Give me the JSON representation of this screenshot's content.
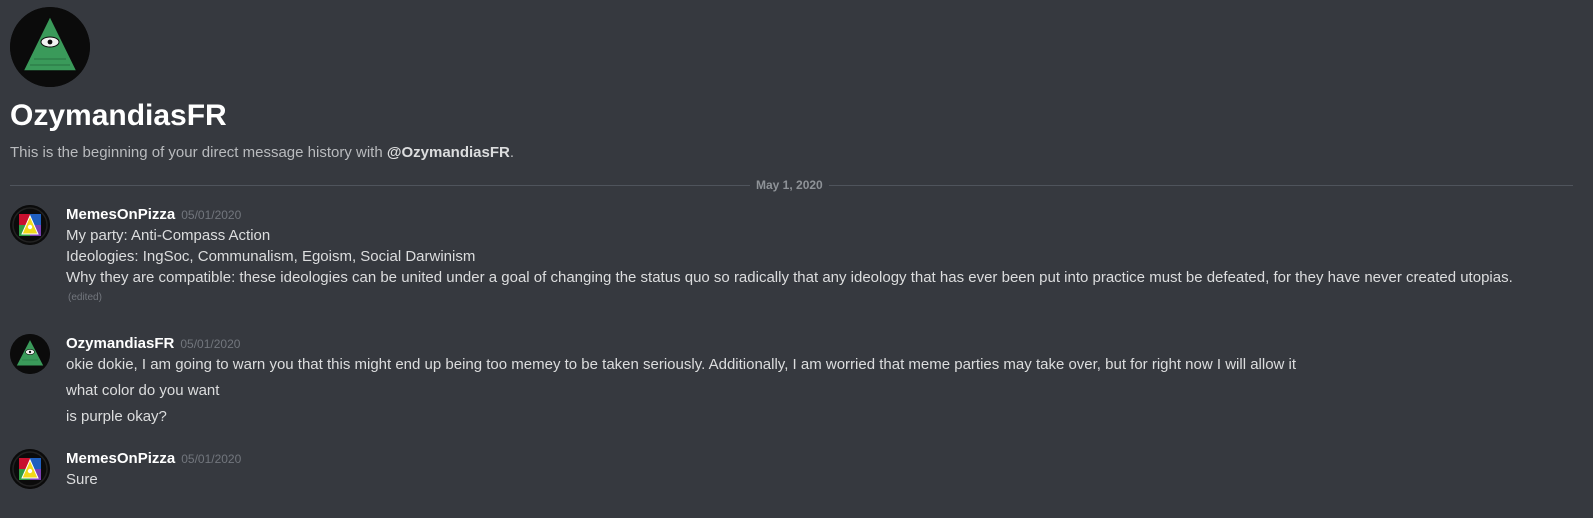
{
  "channel": {
    "title": "OzymandiasFR",
    "intro_prefix": "This is the beginning of your direct message history with ",
    "intro_mention": "@OzymandiasFR",
    "intro_suffix": "."
  },
  "divider": {
    "label": "May 1, 2020"
  },
  "messages": [
    {
      "author": "MemesOnPizza",
      "timestamp": "05/01/2020",
      "lines": [
        "My party: Anti-Compass Action",
        "Ideologies: IngSoc, Communalism, Egoism, Social Darwinism",
        "Why they are compatible: these ideologies can be united under a goal of changing the status quo so radically that any ideology that has ever been put into practice must be defeated, for they have never created utopias."
      ],
      "edited_label": "(edited)"
    },
    {
      "author": "OzymandiasFR",
      "timestamp": "05/01/2020",
      "lines": [
        "okie dokie, I am going to warn you that this might end up being too memey to be taken seriously. Additionally, I am worried that meme parties may take over, but for right now I will allow it",
        "what color do you want",
        "is purple okay?"
      ]
    },
    {
      "author": "MemesOnPizza",
      "timestamp": "05/01/2020",
      "lines": [
        "Sure"
      ]
    }
  ],
  "colors": {
    "background": "#36393f",
    "text": "#dcddde",
    "muted": "#72767d",
    "divider": "#4f545c",
    "avatar_green": "#3a9a5a"
  },
  "icons": {
    "ozymandias_avatar": "illuminati-eye-pyramid-icon",
    "memesonpizza_avatar": "political-compass-emblem-icon"
  }
}
